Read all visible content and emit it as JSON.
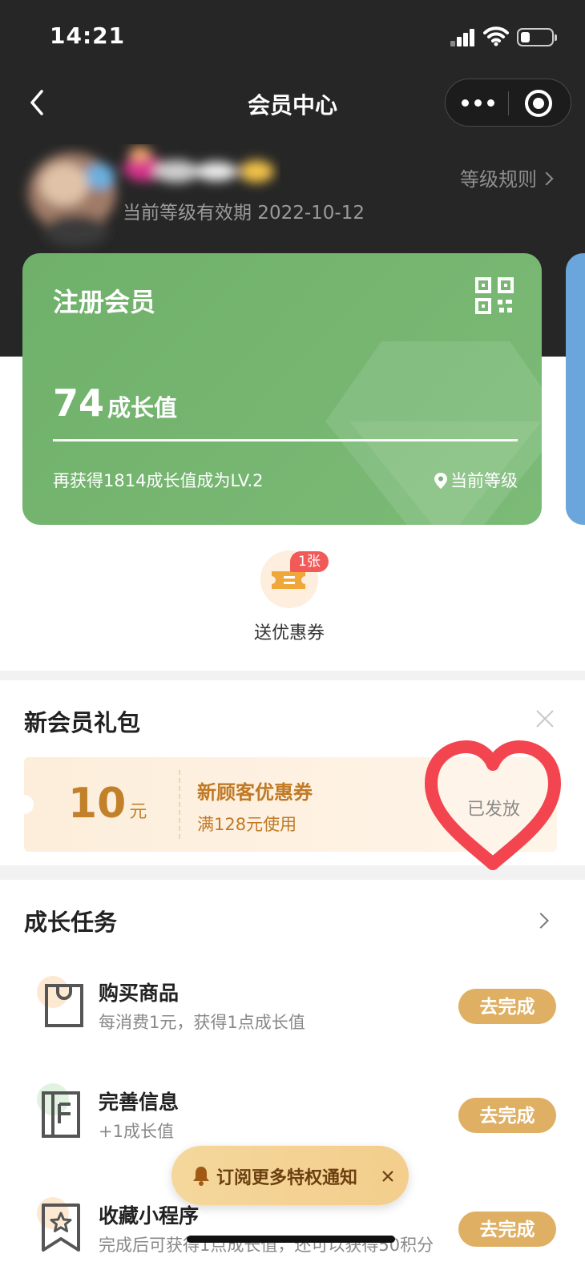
{
  "status_bar": {
    "time": "14:21"
  },
  "nav": {
    "title": "会员中心"
  },
  "user": {
    "validity": "当前等级有效期 2022-10-12",
    "rules_link": "等级规则"
  },
  "member_card": {
    "level_name": "注册会员",
    "points_value": "74",
    "points_label": "成长值",
    "progress": 1.0,
    "next_level_hint": "再获得1814成长值成为LV.2",
    "current_level_label": "当前等级",
    "color": "#76b672"
  },
  "coupon_shortcut": {
    "label": "送优惠券",
    "badge": "1张"
  },
  "gift_pack": {
    "title": "新会员礼包",
    "coupon": {
      "amount": "10",
      "unit": "元",
      "name": "新顾客优惠券",
      "condition": "满128元使用",
      "status": "已发放"
    }
  },
  "tasks": {
    "title": "成长任务",
    "items": [
      {
        "name": "购买商品",
        "desc": "每消费1元，获得1点成长值",
        "button": "去完成"
      },
      {
        "name": "完善信息",
        "desc": "+1成长值",
        "button": "去完成"
      },
      {
        "name": "收藏小程序",
        "desc": "完成后可获得1点成长值，还可以获得50积分",
        "button": "去完成"
      }
    ]
  },
  "subscribe": {
    "label": "订阅更多特权通知"
  },
  "colors": {
    "accent_gold": "#dfaf63",
    "card_green": "#76b672",
    "badge_red": "#f25a5a",
    "heart_red": "#f2454f"
  }
}
